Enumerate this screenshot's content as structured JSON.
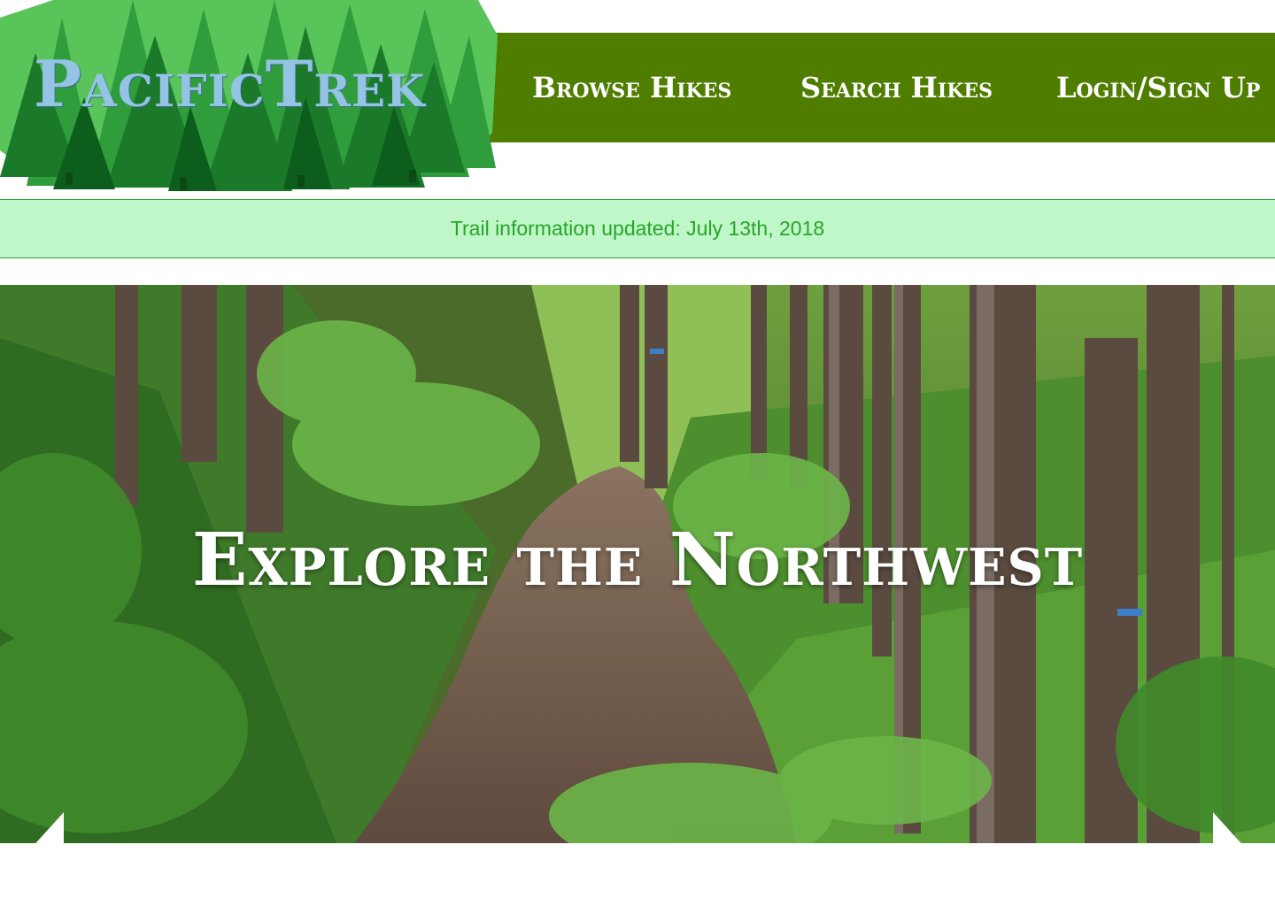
{
  "header": {
    "logo_text": "PacificTrek",
    "nav": {
      "browse": "Browse Hikes",
      "search": "Search Hikes",
      "login": "Login/Sign Up"
    }
  },
  "notice": {
    "text": "Trail information updated: July 13th, 2018"
  },
  "hero": {
    "title": "Explore the Northwest",
    "prev_icon": "chevron-left-icon",
    "next_icon": "chevron-right-icon"
  },
  "colors": {
    "nav_bg": "#4f7d00",
    "notice_bg": "#c0f7c8",
    "notice_text": "#27a52a",
    "logo_text": "#94c3e3"
  }
}
